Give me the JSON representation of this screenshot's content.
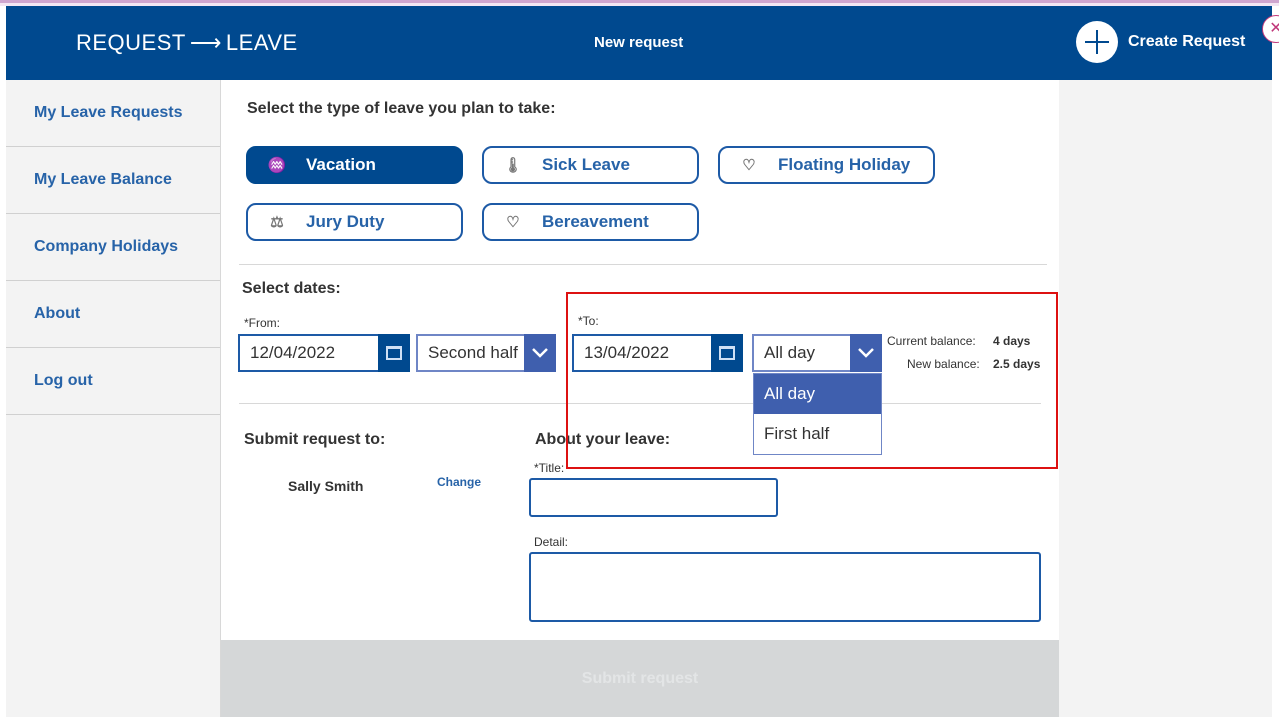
{
  "header": {
    "brand_left": "REQUEST",
    "brand_arrow": "⟶",
    "brand_right": "LEAVE",
    "title": "New request",
    "create_label": "Create Request"
  },
  "sidebar": {
    "items": [
      {
        "label": "My Leave Requests"
      },
      {
        "label": "My Leave Balance"
      },
      {
        "label": "Company Holidays"
      },
      {
        "label": "About"
      },
      {
        "label": "Log out"
      }
    ]
  },
  "leave_type": {
    "prompt": "Select the type of leave you plan to take:",
    "options": [
      {
        "label": "Vacation",
        "icon": "pool-icon",
        "selected": true
      },
      {
        "label": "Sick Leave",
        "icon": "thermometer-icon",
        "selected": false
      },
      {
        "label": "Floating Holiday",
        "icon": "balloons-icon",
        "selected": false
      },
      {
        "label": "Jury Duty",
        "icon": "scales-icon",
        "selected": false
      },
      {
        "label": "Bereavement",
        "icon": "broken-heart-icon",
        "selected": false
      }
    ]
  },
  "dates": {
    "title": "Select dates:",
    "from_label": "*From:",
    "from_value": "12/04/2022",
    "from_part": "Second half",
    "to_label": "*To:",
    "to_value": "13/04/2022",
    "to_part": "All day",
    "to_part_options": [
      "All day",
      "First half"
    ]
  },
  "balance": {
    "current_label": "Current balance:",
    "current_value": "4 days",
    "new_label": "New balance:",
    "new_value": "2.5 days"
  },
  "submit_to": {
    "title": "Submit request to:",
    "approver": "Sally Smith",
    "change_label": "Change"
  },
  "about": {
    "title": "About your leave:",
    "title_label": "*Title:",
    "detail_label": "Detail:"
  },
  "submit_label": "Submit request",
  "colors": {
    "primary": "#00498f",
    "accent": "#1d5aa6",
    "dropdown": "#3f5fae",
    "highlight": "#dd1111"
  }
}
